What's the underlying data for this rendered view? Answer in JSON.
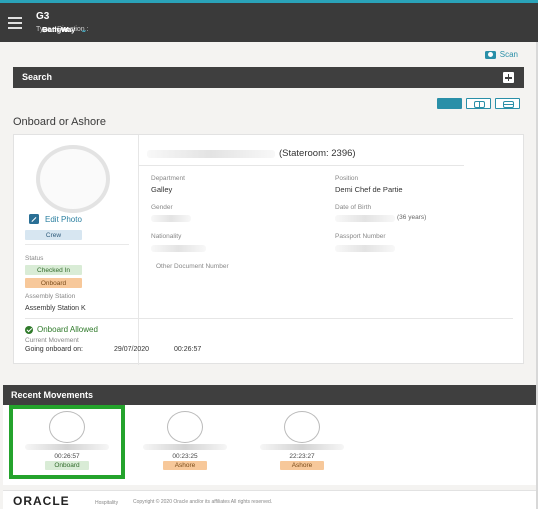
{
  "header": {
    "location": "G3",
    "type_label": "Type :",
    "type_value": "Gangway",
    "direction_label": "Direction :",
    "direction_value": "Both W..."
  },
  "scan_label": "Scan",
  "search_label": "Search",
  "section_title": "Onboard or Ashore",
  "profile": {
    "edit_photo": "Edit Photo",
    "role_badge": "Crew",
    "status_label": "Status",
    "status_checked": "Checked In",
    "status_onboard": "Onboard",
    "assembly_label": "Assembly Station",
    "assembly_value": "Assembly Station K",
    "stateroom": "(Stateroom: 2396)",
    "department_label": "Department",
    "department_value": "Galley",
    "position_label": "Position",
    "position_value": "Demi Chef de Partie",
    "gender_label": "Gender",
    "dob_label": "Date of Birth",
    "dob_age": "(36 years)",
    "nationality_label": "Nationality",
    "passport_label": "Passport Number",
    "other_doc_label": "Other Document Number",
    "allowed_text": "Onboard Allowed",
    "current_movement_label": "Current Movement",
    "going_onboard_label": "Going onboard on:",
    "going_onboard_date": "29/07/2020",
    "going_onboard_time": "00:26:57"
  },
  "recent": {
    "title": "Recent Movements",
    "items": [
      {
        "time": "00:26:57",
        "tag": "Onboard",
        "kind": "on"
      },
      {
        "time": "00:23:25",
        "tag": "Ashore",
        "kind": "off"
      },
      {
        "time": "22:23:27",
        "tag": "Ashore",
        "kind": "off"
      }
    ]
  },
  "footer": {
    "brand": "ORACLE",
    "sub": "Hospitality",
    "copyright": "Copyright © 2020 Oracle and/or its affiliates All rights reserved."
  }
}
